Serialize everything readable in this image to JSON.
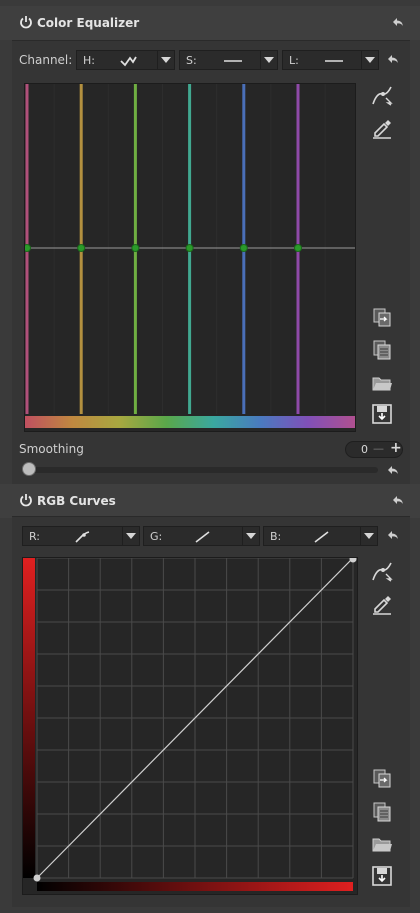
{
  "color_equalizer": {
    "title": "Color Equalizer",
    "channel_label": "Channel:",
    "channels": [
      {
        "label": "H:",
        "curve": "wave"
      },
      {
        "label": "S:",
        "curve": "flat"
      },
      {
        "label": "L:",
        "curve": "flat"
      }
    ],
    "band_colors": [
      "#b0507a",
      "#b3903f",
      "#6fae42",
      "#41a890",
      "#4a6fb8",
      "#8f4aa8"
    ],
    "smoothing_label": "Smoothing",
    "smoothing_value": "0",
    "minus_label": "—",
    "plus_label": "+",
    "smoothing_fraction": 0
  },
  "rgb_curves": {
    "title": "RGB Curves",
    "channels": [
      {
        "label": "R:",
        "curve": "custom"
      },
      {
        "label": "G:",
        "curve": "linear"
      },
      {
        "label": "B:",
        "curve": "linear"
      }
    ],
    "curve_color": "#e02020"
  },
  "icons": [
    "power-icon",
    "reset-icon",
    "pick-curve-icon",
    "eyedropper-icon",
    "copy-icon",
    "paste-icon",
    "open-folder-icon",
    "save-icon"
  ]
}
